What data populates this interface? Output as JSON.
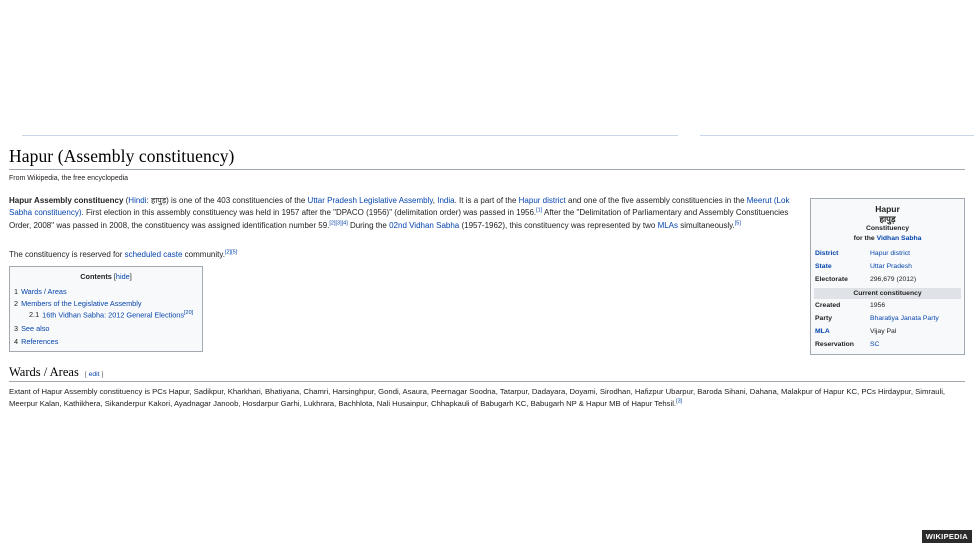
{
  "title": "Hapur (Assembly constituency)",
  "tagline": "From Wikipedia, the free encyclopedia",
  "lead": {
    "bold": "Hapur Assembly constituency",
    "t1": " (",
    "hindi_link": "Hindi",
    "t2": ": हापुड़) is one of the 403 constituencies of the ",
    "upla_link": "Uttar Pradesh Legislative Assembly",
    "t3": ", ",
    "india_link": "India",
    "t4": ". It is a part of the ",
    "district_link": "Hapur district",
    "t5": " and one of the five assembly constituencies in the ",
    "meerut_link": "Meerut (Lok Sabha constituency)",
    "t6": ". First election in this assembly constituency was held in 1957 after the \"DPACO (1956)\" (delimitation order) was passed in 1956.",
    "ref1": "[1]",
    "t7": " After the \"Delimitation of Parliamentary and Assembly Constituencies Order, 2008\" was passed in 2008, the constituency was assigned identification number 59.",
    "ref2": "[2][3][4]",
    "t8": " During the ",
    "vidhan_link": "02nd Vidhan Sabha",
    "t9": " (1957-1962), this constituency was represented by two ",
    "mlas_link": "MLAs",
    "t10": " simultaneously.",
    "ref3": "[5]"
  },
  "p2": {
    "t1": "The constituency is reserved for ",
    "sc_link": "scheduled caste",
    "t2": " community.",
    "ref": "[2][5]"
  },
  "toc": {
    "heading": "Contents",
    "hide_left": "[",
    "hide_label": "hide",
    "hide_right": "]",
    "items": [
      {
        "num": "1",
        "label": "Wards / Areas"
      },
      {
        "num": "2",
        "label": "Members of the Legislative Assembly"
      },
      {
        "num": "2.1",
        "label": "16th Vidhan Sabha: 2012 General Elections",
        "sup": "[20]"
      },
      {
        "num": "3",
        "label": "See also"
      },
      {
        "num": "4",
        "label": "References"
      }
    ]
  },
  "infobox": {
    "title": "Hapur",
    "title_hi": "हापुड़",
    "subtitle": "Constituency",
    "for_text": "for the ",
    "for_link": "Vidhan Sabha",
    "rows": [
      {
        "label": "District",
        "value": "Hapur district"
      },
      {
        "label": "State",
        "value": "Uttar Pradesh"
      },
      {
        "label": "Electorate",
        "value": "296,679 (2012)"
      }
    ],
    "section": "Current constituency",
    "rows2": [
      {
        "label": "Created",
        "value": "1956"
      },
      {
        "label": "Party",
        "value": "Bharatiya Janata Party"
      },
      {
        "label": "MLA",
        "value": "Vijay Pal"
      },
      {
        "label": "Reservation",
        "value": "SC"
      }
    ]
  },
  "section": {
    "heading": "Wards / Areas",
    "edit_left": "[",
    "edit_label": "edit",
    "edit_right": "]"
  },
  "wards": {
    "text": "Extant of Hapur Assembly constituency is PCs Hapur, Sadikpur, Kharkhari, Bhatiyana, Chamri, Harsinghpur, Gondi, Asaura, Peernagar Soodna, Tatarpur, Dadayara, Doyami, Sirodhan, Hafizpur Ubarpur, Baroda Sihani, Dahana, Malakpur of Hapur KC, PCs Hirdaypur, Simrauli, Meerpur Kalan, Kathikhera, Sikanderpur Kakori, Ayadnagar Janoob, Hosdarpur Garhi, Lukhrara, Bachhlota, Nali Husainpur, Chhapkauli of Babugarh KC, Babugarh NP & Hapur MB of Hapur Tehsil.",
    "ref": "[3]"
  },
  "watermark": "WIKIPEDIA",
  "colors": {
    "link": "#0645ad",
    "border": "#a2a9b1",
    "infobox_bg": "#f8f9fa"
  }
}
